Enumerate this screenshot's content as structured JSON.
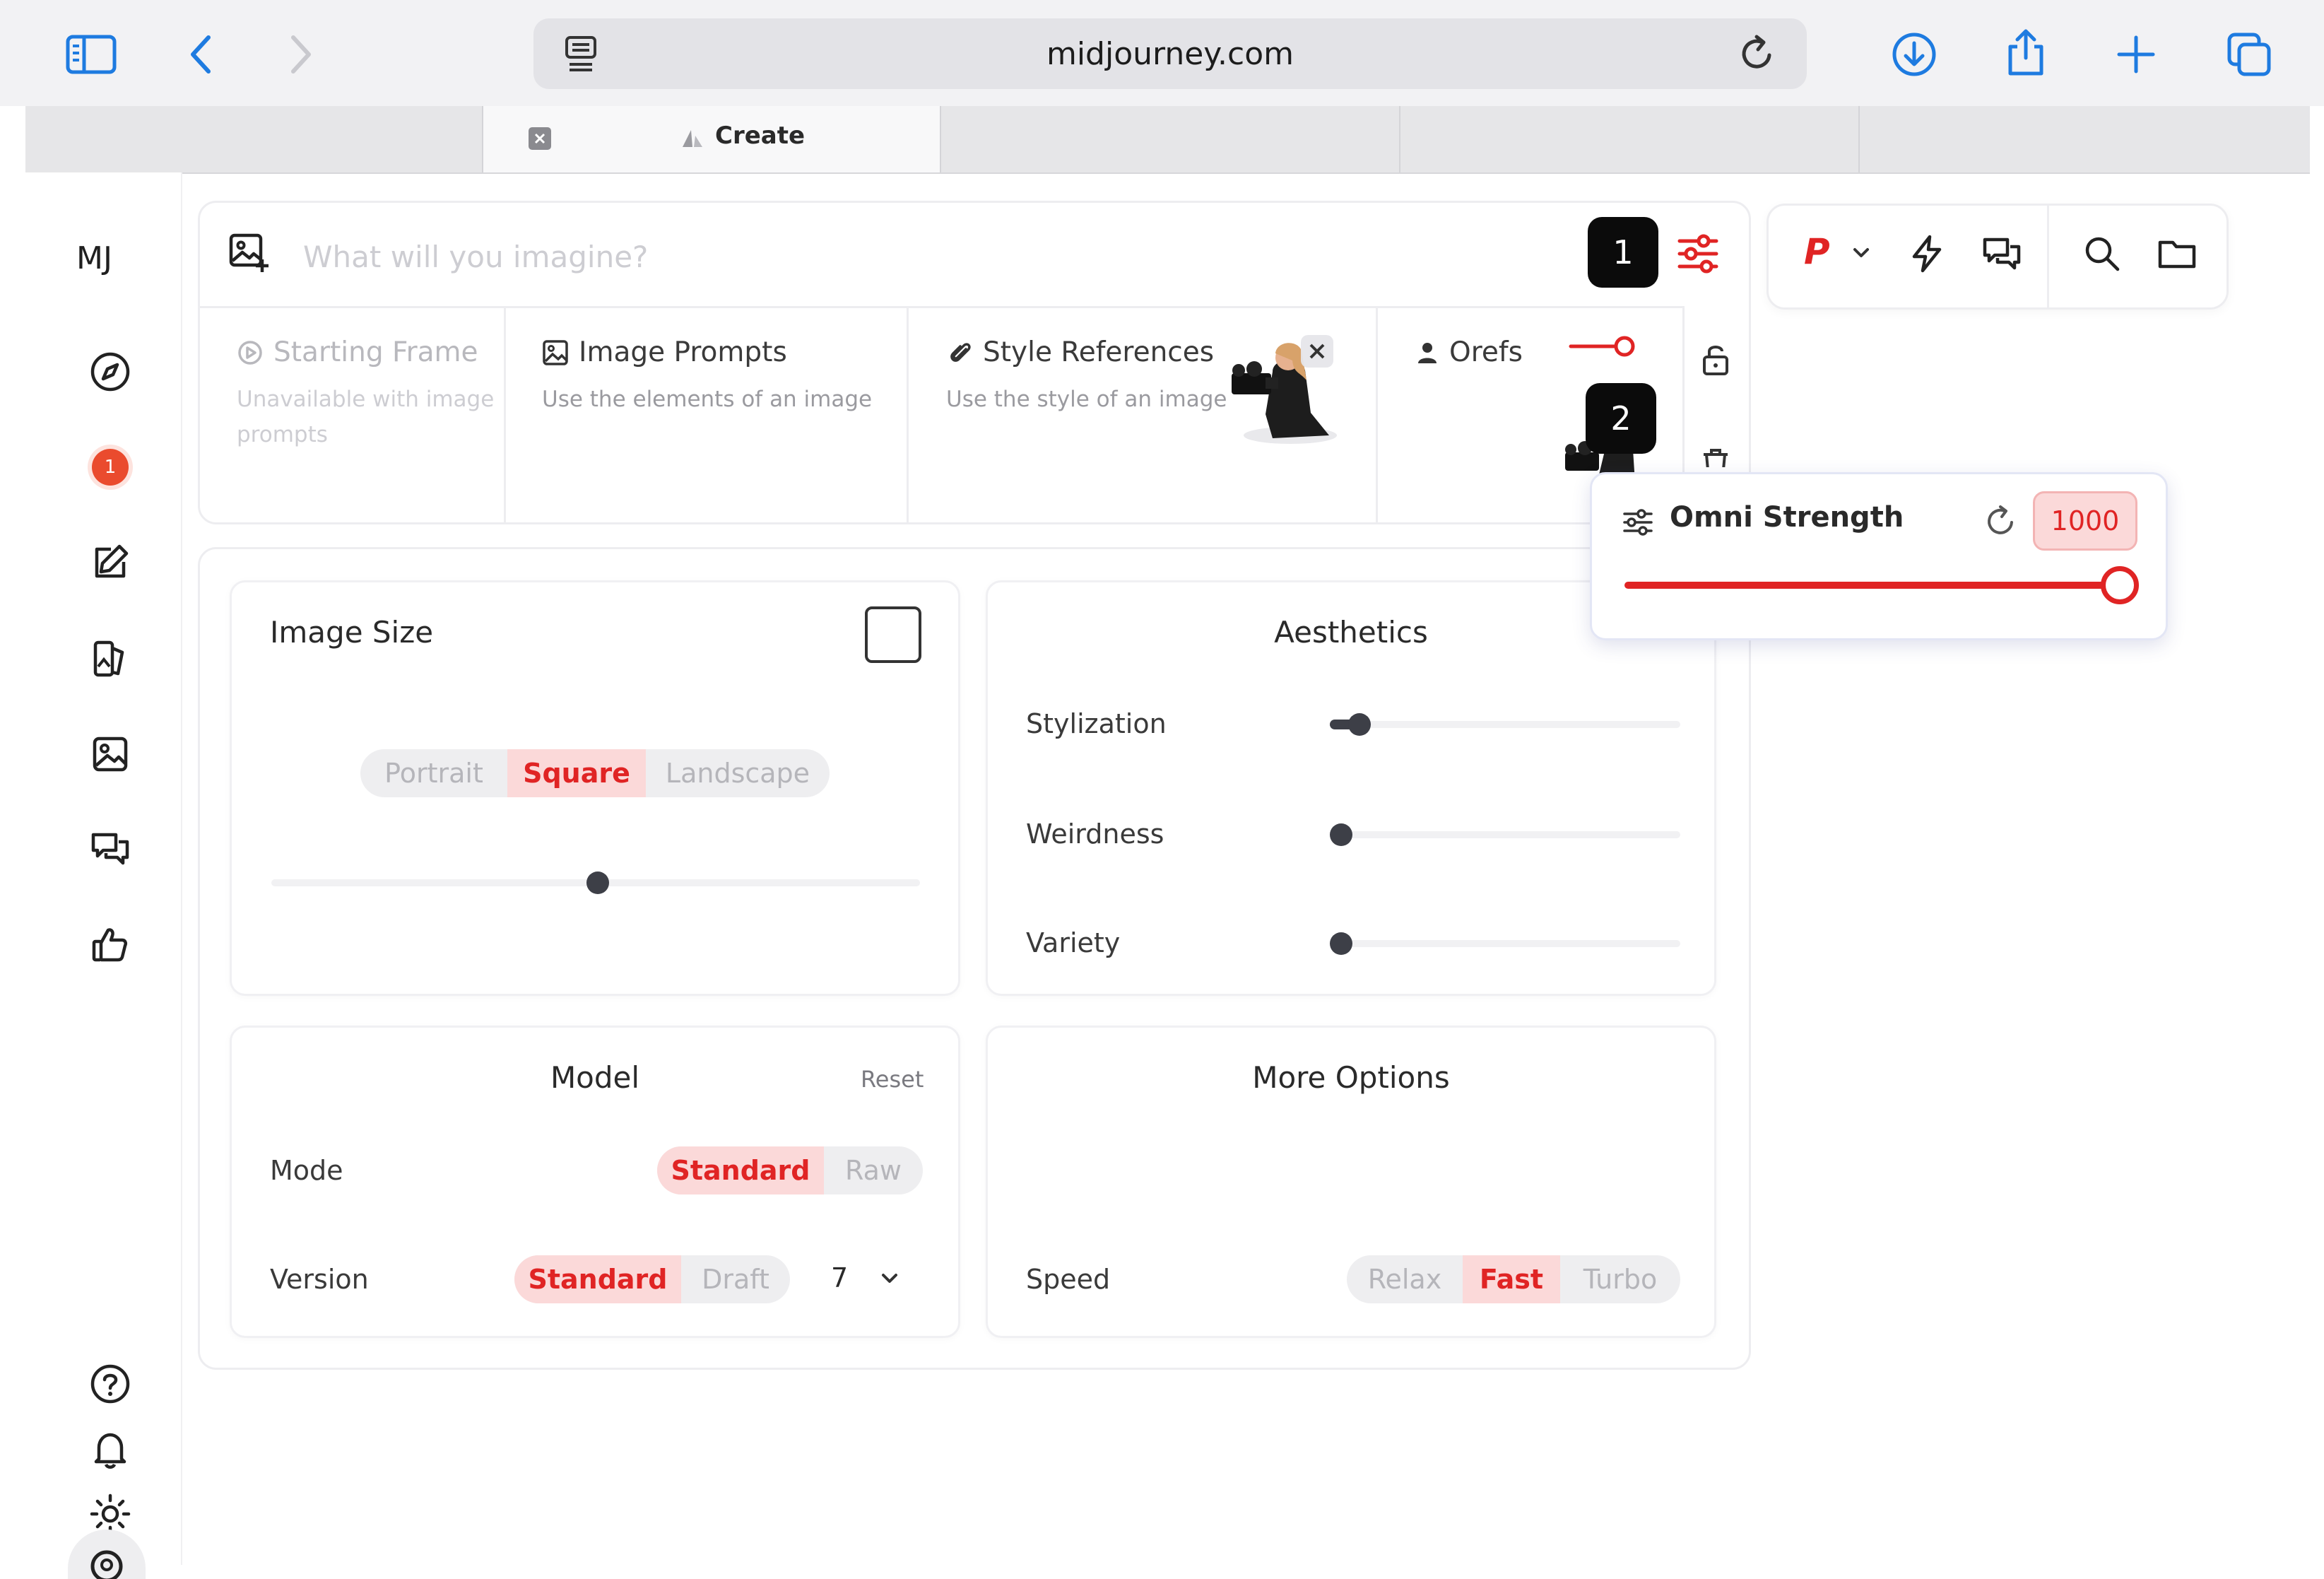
{
  "browser": {
    "url": "midjourney.com",
    "tabs": [
      {
        "label": ""
      },
      {
        "label": "Create",
        "active": true
      },
      {
        "label": ""
      },
      {
        "label": ""
      }
    ],
    "icons": [
      "sidebar-icon",
      "back-icon",
      "forward-icon",
      "reader-icon",
      "reload-icon",
      "download-icon",
      "share-icon",
      "new-tab-icon",
      "tabs-overview-icon"
    ]
  },
  "sidebar": {
    "logo": "MJ",
    "notification_count": "1",
    "icons": [
      "explore-icon",
      "notification-icon",
      "create-icon",
      "edit-icon",
      "organize-icon",
      "chat-icon",
      "likes-icon",
      "help-icon",
      "bell-icon",
      "theme-icon",
      "account-icon"
    ]
  },
  "prompt": {
    "placeholder": "What will you imagine?",
    "badge1": "1",
    "badge2": "2"
  },
  "references": {
    "starting_frame": {
      "title": "Starting Frame",
      "subtitle_line1": "Unavailable with image",
      "subtitle_line2": "prompts"
    },
    "image_prompts": {
      "title": "Image Prompts",
      "subtitle": "Use the elements of an image"
    },
    "style_references": {
      "title": "Style References",
      "subtitle": "Use the style of an image"
    },
    "orefs": {
      "title": "Orefs"
    }
  },
  "right_tools": {
    "personalize_label": "P",
    "icons": [
      "personalize-icon",
      "speed-icon",
      "chat-icon",
      "search-icon",
      "folder-icon"
    ]
  },
  "omni": {
    "label": "Omni Strength",
    "value": "1000",
    "level": 1.0
  },
  "image_size": {
    "title": "Image Size",
    "options": [
      "Portrait",
      "Square",
      "Landscape"
    ],
    "selected": "Square",
    "aspect_slider": 0.5
  },
  "aesthetics": {
    "title": "Aesthetics",
    "sliders": [
      {
        "label": "Stylization",
        "level": 0.05
      },
      {
        "label": "Weirdness",
        "level": 0.0
      },
      {
        "label": "Variety",
        "level": 0.0
      }
    ]
  },
  "model": {
    "title": "Model",
    "reset_label": "Reset",
    "mode_label": "Mode",
    "mode_options": [
      "Standard",
      "Raw"
    ],
    "mode_selected": "Standard",
    "version_label": "Version",
    "version_options": [
      "Standard",
      "Draft"
    ],
    "version_selected": "Standard",
    "version_number": "7"
  },
  "more_options": {
    "title": "More Options",
    "speed_label": "Speed",
    "speed_options": [
      "Relax",
      "Fast",
      "Turbo"
    ],
    "speed_selected": "Fast"
  },
  "colors": {
    "accent": "#e02424",
    "accent_soft": "#fbd9d9",
    "badge_bg": "#0b0b0b",
    "notification": "#ea4b2e"
  }
}
